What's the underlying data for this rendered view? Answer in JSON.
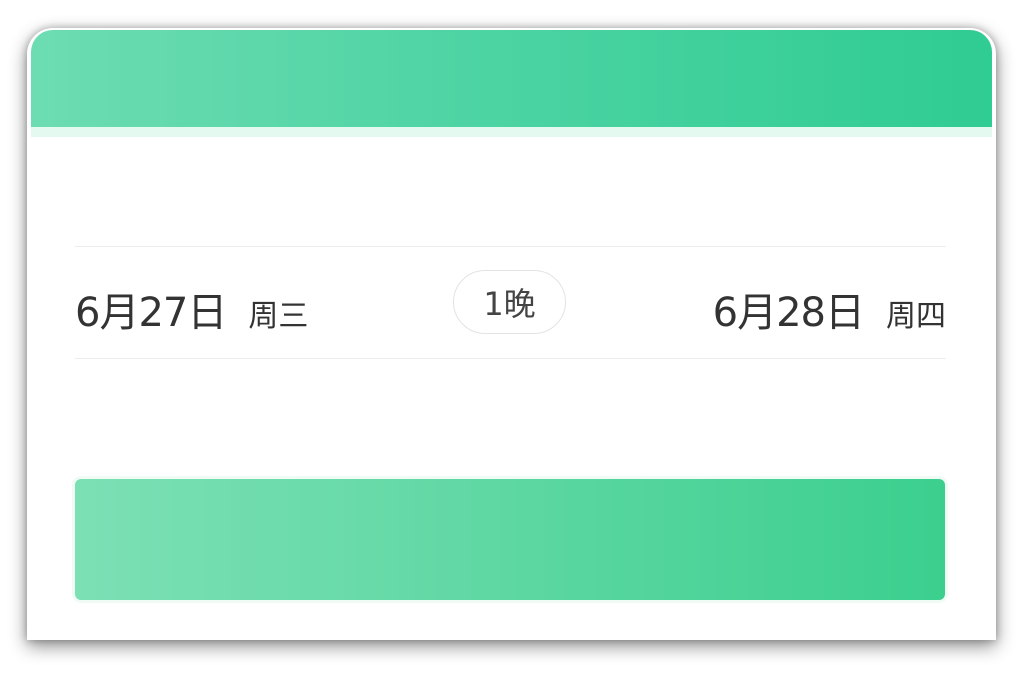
{
  "booking": {
    "checkin": {
      "date": "6月27日",
      "weekday": "周三"
    },
    "nights": "1晚",
    "checkout": {
      "date": "6月28日",
      "weekday": "周四"
    }
  },
  "search_button": {
    "label": ""
  },
  "colors": {
    "header_gradient_start": "#6ddcb2",
    "header_gradient_end": "#2fcc93",
    "button_gradient_start": "#7ce0b5",
    "button_gradient_end": "#3bcf8e",
    "text_primary": "#333333"
  }
}
